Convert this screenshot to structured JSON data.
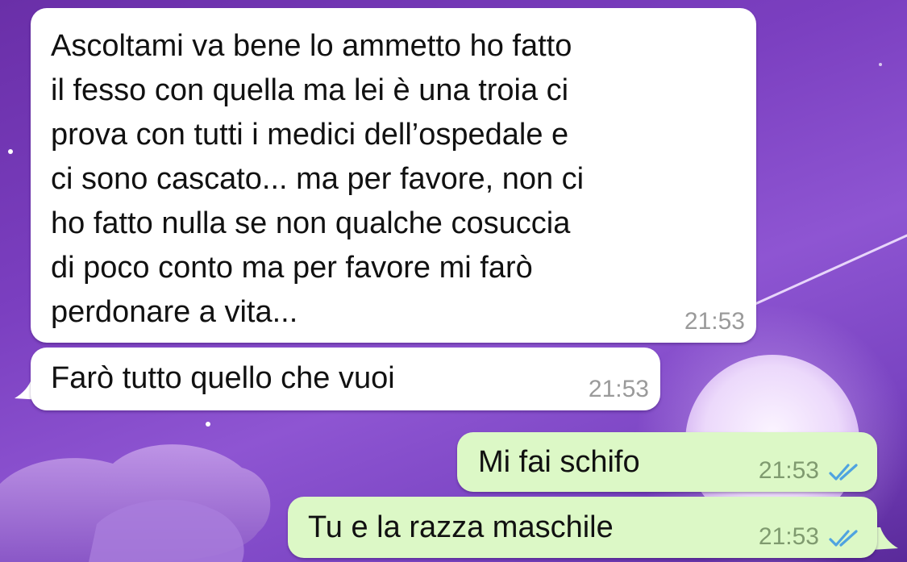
{
  "colors": {
    "incoming_bubble": "#ffffff",
    "outgoing_bubble": "#dcf8c6",
    "read_ticks": "#4fa3e0",
    "wallpaper": "#7b3fc0"
  },
  "messages": [
    {
      "direction": "incoming",
      "text": "Ascoltami va bene lo ammetto ho fatto\nil fesso con quella ma lei è una troia ci\nprova con tutti i medici dell’ospedale e\nci sono cascato... ma per favore, non ci\nho fatto nulla se non qualche cosuccia\ndi poco conto ma per favore mi farò\nperdonare a vita...",
      "time": "21:53"
    },
    {
      "direction": "incoming",
      "text": "Farò tutto quello che vuoi",
      "time": "21:53"
    },
    {
      "direction": "outgoing",
      "text": "Mi fai schifo",
      "time": "21:53",
      "status_icon": "double-check-read-icon"
    },
    {
      "direction": "outgoing",
      "text": "Tu e la razza maschile",
      "time": "21:53",
      "status_icon": "double-check-read-icon"
    }
  ]
}
